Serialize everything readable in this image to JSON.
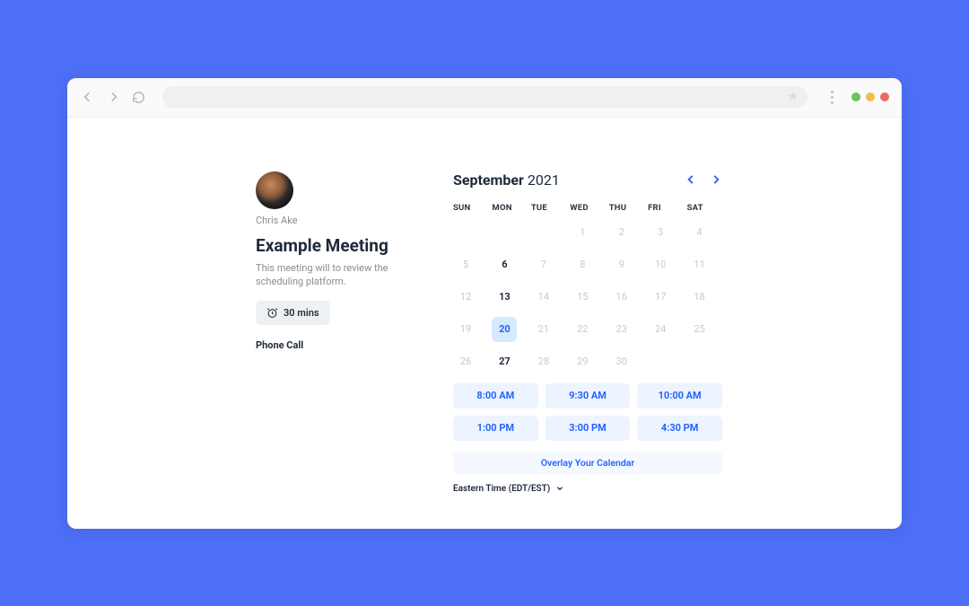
{
  "meeting": {
    "host_name": "Chris Ake",
    "title": "Example Meeting",
    "description": "This meeting will to review the scheduling platform.",
    "duration": "30 mins",
    "type": "Phone Call"
  },
  "calendar": {
    "month": "September",
    "year": "2021",
    "dow": [
      "SUN",
      "MON",
      "TUE",
      "WED",
      "THU",
      "FRI",
      "SAT"
    ],
    "weeks": [
      [
        {
          "n": "",
          "empty": true
        },
        {
          "n": "",
          "empty": true
        },
        {
          "n": "",
          "empty": true
        },
        {
          "n": "1"
        },
        {
          "n": "2"
        },
        {
          "n": "3"
        },
        {
          "n": "4"
        }
      ],
      [
        {
          "n": "5"
        },
        {
          "n": "6",
          "avail": true
        },
        {
          "n": "7"
        },
        {
          "n": "8"
        },
        {
          "n": "9"
        },
        {
          "n": "10"
        },
        {
          "n": "11"
        }
      ],
      [
        {
          "n": "12"
        },
        {
          "n": "13",
          "avail": true
        },
        {
          "n": "14"
        },
        {
          "n": "15"
        },
        {
          "n": "16"
        },
        {
          "n": "17"
        },
        {
          "n": "18"
        }
      ],
      [
        {
          "n": "19"
        },
        {
          "n": "20",
          "selected": true
        },
        {
          "n": "21"
        },
        {
          "n": "22"
        },
        {
          "n": "23"
        },
        {
          "n": "24"
        },
        {
          "n": "25"
        }
      ],
      [
        {
          "n": "26"
        },
        {
          "n": "27",
          "avail": true
        },
        {
          "n": "28"
        },
        {
          "n": "29"
        },
        {
          "n": "30"
        },
        {
          "n": "",
          "empty": true
        },
        {
          "n": "",
          "empty": true
        }
      ]
    ],
    "slots": [
      "8:00 AM",
      "9:30 AM",
      "10:00 AM",
      "1:00 PM",
      "3:00 PM",
      "4:30 PM"
    ],
    "overlay_label": "Overlay Your Calendar",
    "timezone": "Eastern Time (EDT/EST)"
  }
}
